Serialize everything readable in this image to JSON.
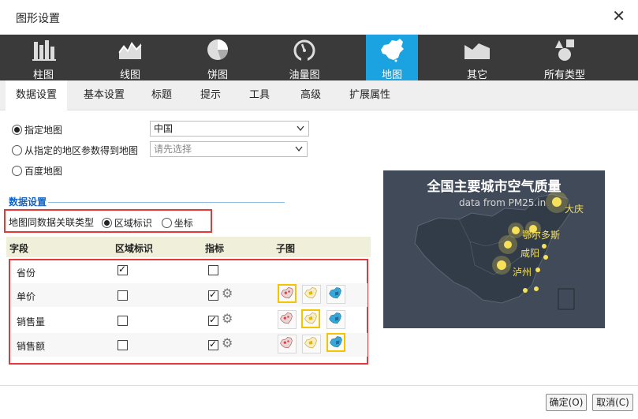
{
  "dialog": {
    "title": "图形设置"
  },
  "chart_types": [
    {
      "label": "柱图",
      "icon": "bar-chart-icon"
    },
    {
      "label": "线图",
      "icon": "area-chart-icon"
    },
    {
      "label": "饼图",
      "icon": "pie-chart-icon"
    },
    {
      "label": "油量图",
      "icon": "gauge-icon"
    },
    {
      "label": "地图",
      "icon": "china-map-icon",
      "active": true
    },
    {
      "label": "其它",
      "icon": "other-chart-icon"
    },
    {
      "label": "所有类型",
      "icon": "shapes-icon"
    }
  ],
  "tabs": [
    {
      "label": "数据设置",
      "active": true
    },
    {
      "label": "基本设置"
    },
    {
      "label": "标题"
    },
    {
      "label": "提示"
    },
    {
      "label": "工具"
    },
    {
      "label": "高级"
    },
    {
      "label": "扩展属性"
    }
  ],
  "map_source": {
    "option_specified": "指定地图",
    "specified_value": "中国",
    "option_param": "从指定的地区参数得到地图",
    "param_placeholder": "请先选择",
    "option_baidu": "百度地图",
    "selected": "specified"
  },
  "data_section": {
    "title": "数据设置",
    "assoc_label": "地图同数据关联类型",
    "assoc_region": "区域标识",
    "assoc_coord": "坐标",
    "assoc_selected": "region"
  },
  "field_table": {
    "headers": [
      "字段",
      "区域标识",
      "指标",
      "子图"
    ],
    "rows": [
      {
        "field": "省份",
        "region": true,
        "metric": false,
        "gear": false,
        "subchart": null
      },
      {
        "field": "单价",
        "region": false,
        "metric": true,
        "gear": true,
        "subchart": 0
      },
      {
        "field": "销售量",
        "region": false,
        "metric": true,
        "gear": true,
        "subchart": 1
      },
      {
        "field": "销售额",
        "region": false,
        "metric": true,
        "gear": true,
        "subchart": 2
      }
    ],
    "subchart_thumbs": [
      "map-thumb-red-icon",
      "map-thumb-yellow-icon",
      "map-thumb-blue-icon"
    ]
  },
  "preview": {
    "title": "全国主要城市空气质量",
    "subtitle": "data from PM25.in",
    "cities": [
      "大庆",
      "鄂尔多斯",
      "咸阳",
      "泸州"
    ]
  },
  "footer": {
    "ok_label": "确定(O)",
    "cancel_label": "取消(C)"
  },
  "colors": {
    "accent": "#1aa3e0",
    "highlight_box": "#e53935",
    "map_bg": "#404a59",
    "map_glow": "#f7e05a"
  }
}
